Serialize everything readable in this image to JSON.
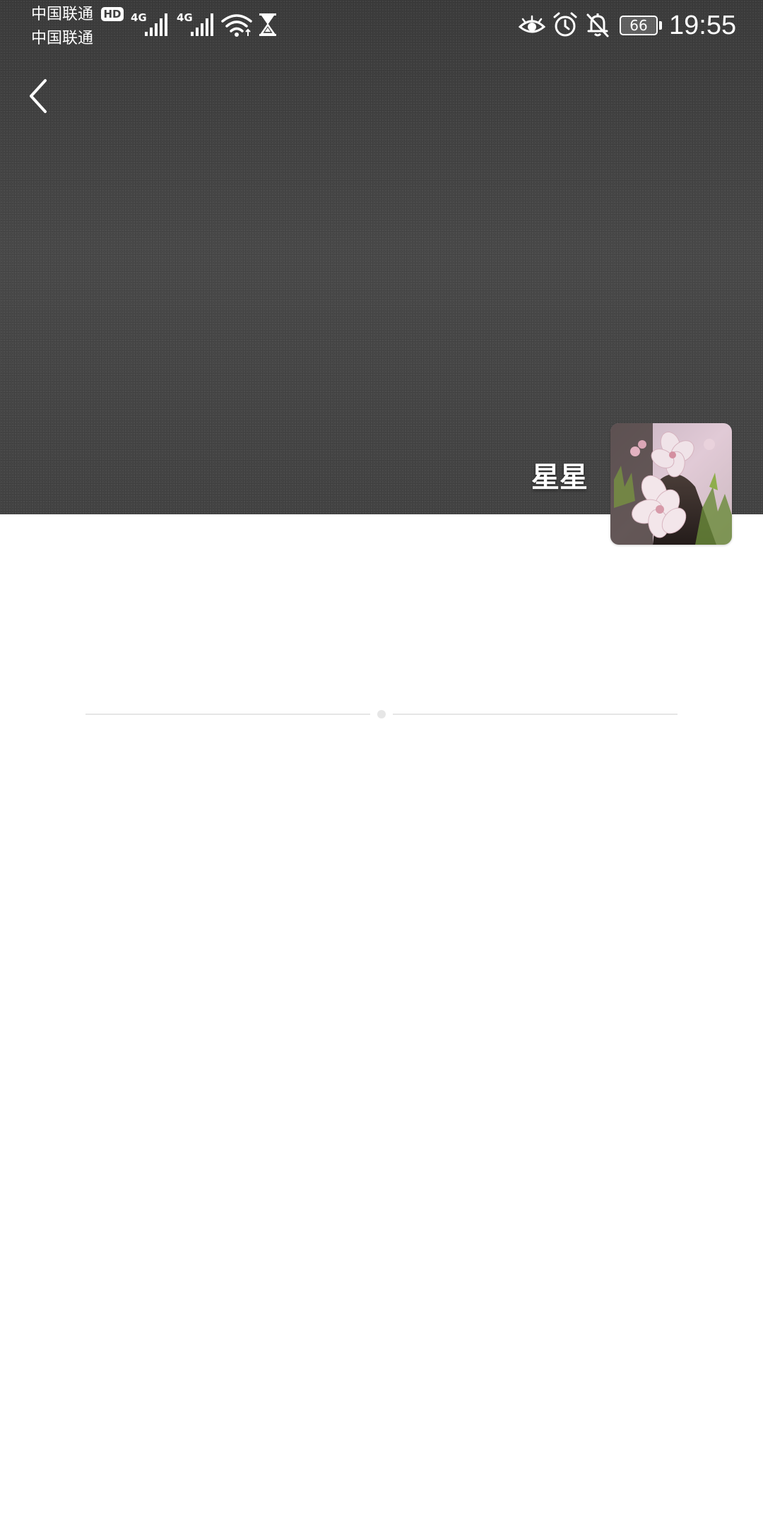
{
  "status_bar": {
    "carrier_1": "中国联通",
    "carrier_2": "中国联通",
    "hd_badge": "HD",
    "network_1": "4G",
    "network_2": "4G",
    "battery_level": "66",
    "time": "19:55",
    "icons": [
      "signal-icon",
      "wifi-icon",
      "hourglass-icon",
      "eye-icon",
      "alarm-icon",
      "bell-off-icon",
      "battery-icon"
    ]
  },
  "header": {
    "back_icon": "chevron-left-icon"
  },
  "profile": {
    "name": "星星",
    "avatar": "cherry-blossom-photo"
  },
  "colors": {
    "cover_background": "#474747",
    "page_background": "#ffffff",
    "divider": "#e6e6e6"
  }
}
